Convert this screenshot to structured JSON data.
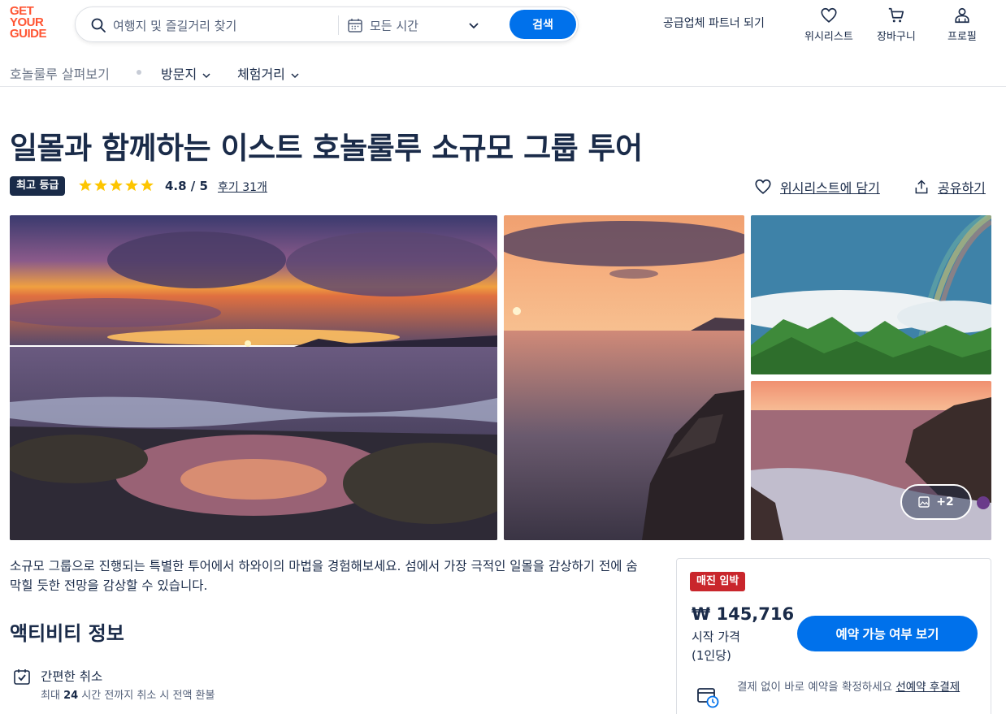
{
  "header": {
    "logo": [
      "GET",
      "YOUR",
      "GUIDE"
    ],
    "search_placeholder": "여행지 및 즐길거리 찾기",
    "date_label": "모든 시간",
    "search_button": "검색",
    "partner_link": "공급업체 파트너 되기",
    "wishlist_label": "위시리스트",
    "cart_label": "장바구니",
    "profile_label": "프로필"
  },
  "subnav": {
    "explore": "호놀룰루 살펴보기",
    "places": "방문지",
    "things": "체험거리"
  },
  "activity": {
    "title": "일몰과 함께하는 이스트 호놀룰루 소규모 그룹 투어",
    "badge": "최고 등급",
    "rating": "4.8 / 5",
    "stars": 5,
    "reviews": "후기 31개",
    "add_wishlist": "위시리스트에 담기",
    "share": "공유하기",
    "more_photos": "+2",
    "description": "소규모 그룹으로 진행되는 특별한 투어에서 하와이의 마법을 경험해보세요. 섬에서 가장 극적인 일몰을 감상하기 전에 숨 막힐 듯한 전망을 감상할 수 있습니다."
  },
  "about": {
    "heading": "액티비티 정보",
    "cancel_title": "간편한 취소",
    "cancel_prefix": "최대 ",
    "cancel_hours": "24",
    "cancel_suffix": " 시간 전까지 취소 시 전액 환불"
  },
  "booking": {
    "badge": "매진 임박",
    "price": "₩ 145,716",
    "price_from": "시작 가격",
    "price_per": "(1인당)",
    "check_button": "예약 가능 여부 보기",
    "pay_text": "결제 없이 바로 예약을 확정하세요 ",
    "pay_link": "선예약 후결제"
  },
  "colors": {
    "primary": "#0071eb",
    "brand": "#ff5533",
    "text": "#1a2b49",
    "sellout": "#c9262c",
    "star": "#fdc500"
  }
}
